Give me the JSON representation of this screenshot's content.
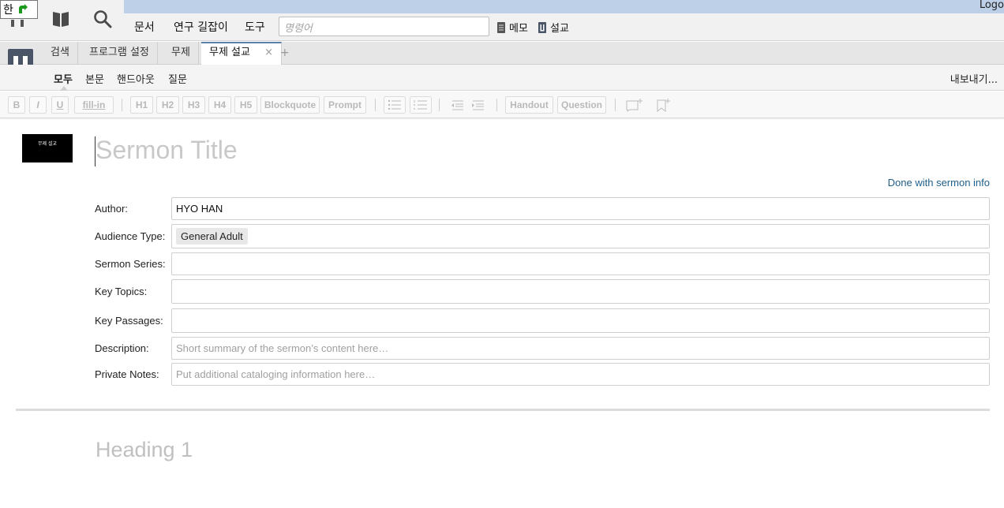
{
  "ime": {
    "text": "한"
  },
  "topbar": {
    "logout": "Logo",
    "menu": [
      "문서",
      "연구 길잡이",
      "도구"
    ],
    "command_placeholder": "명령어",
    "links": {
      "notes": "메모",
      "sermon": "설교"
    },
    "icons": [
      "home-icon",
      "library-icon",
      "search-icon",
      "notes-icon",
      "sermon-icon"
    ]
  },
  "tabs": {
    "items": [
      {
        "label": "검색"
      },
      {
        "label": "프로그램 설정"
      },
      {
        "label": "무제"
      },
      {
        "label": "무제 설교",
        "active": true
      }
    ],
    "close": "×",
    "add": "+"
  },
  "viewbar": {
    "items": [
      "모두",
      "본문",
      "핸드아웃",
      "질문"
    ],
    "active": "모두",
    "export": "내보내기..."
  },
  "toolbar": {
    "buttons": {
      "bold": "B",
      "italic": "I",
      "underline": "U",
      "fill_in": "fill-in",
      "h1": "H1",
      "h2": "H2",
      "h3": "H3",
      "h4": "H4",
      "h5": "H5",
      "blockquote": "Blockquote",
      "prompt": "Prompt",
      "handout": "Handout",
      "question": "Question"
    },
    "icons": [
      "bullet-list-icon",
      "numbered-list-icon",
      "outdent-icon",
      "indent-icon",
      "add-slide-icon",
      "add-bookmark-icon"
    ]
  },
  "document": {
    "thumbnail_text": "무제 설교",
    "title_placeholder": "Sermon Title",
    "done_link": "Done with sermon info",
    "fields": {
      "author": {
        "label": "Author:",
        "value": "HYO HAN"
      },
      "audience": {
        "label": "Audience Type:",
        "value": "General Adult"
      },
      "series": {
        "label": "Sermon Series:",
        "value": ""
      },
      "topics": {
        "label": "Key Topics:",
        "value": ""
      },
      "passages": {
        "label": "Key Passages:",
        "value": ""
      },
      "description": {
        "label": "Description:",
        "placeholder": "Short summary of the sermon’s content here…"
      },
      "notes": {
        "label": "Private Notes:",
        "placeholder": "Put additional cataloging information here…"
      }
    },
    "heading_placeholder": "Heading 1"
  },
  "colors": {
    "accent_blue": "#bdd0e8",
    "link": "#1f5f8b",
    "sermon_icon": "#4a5568"
  }
}
